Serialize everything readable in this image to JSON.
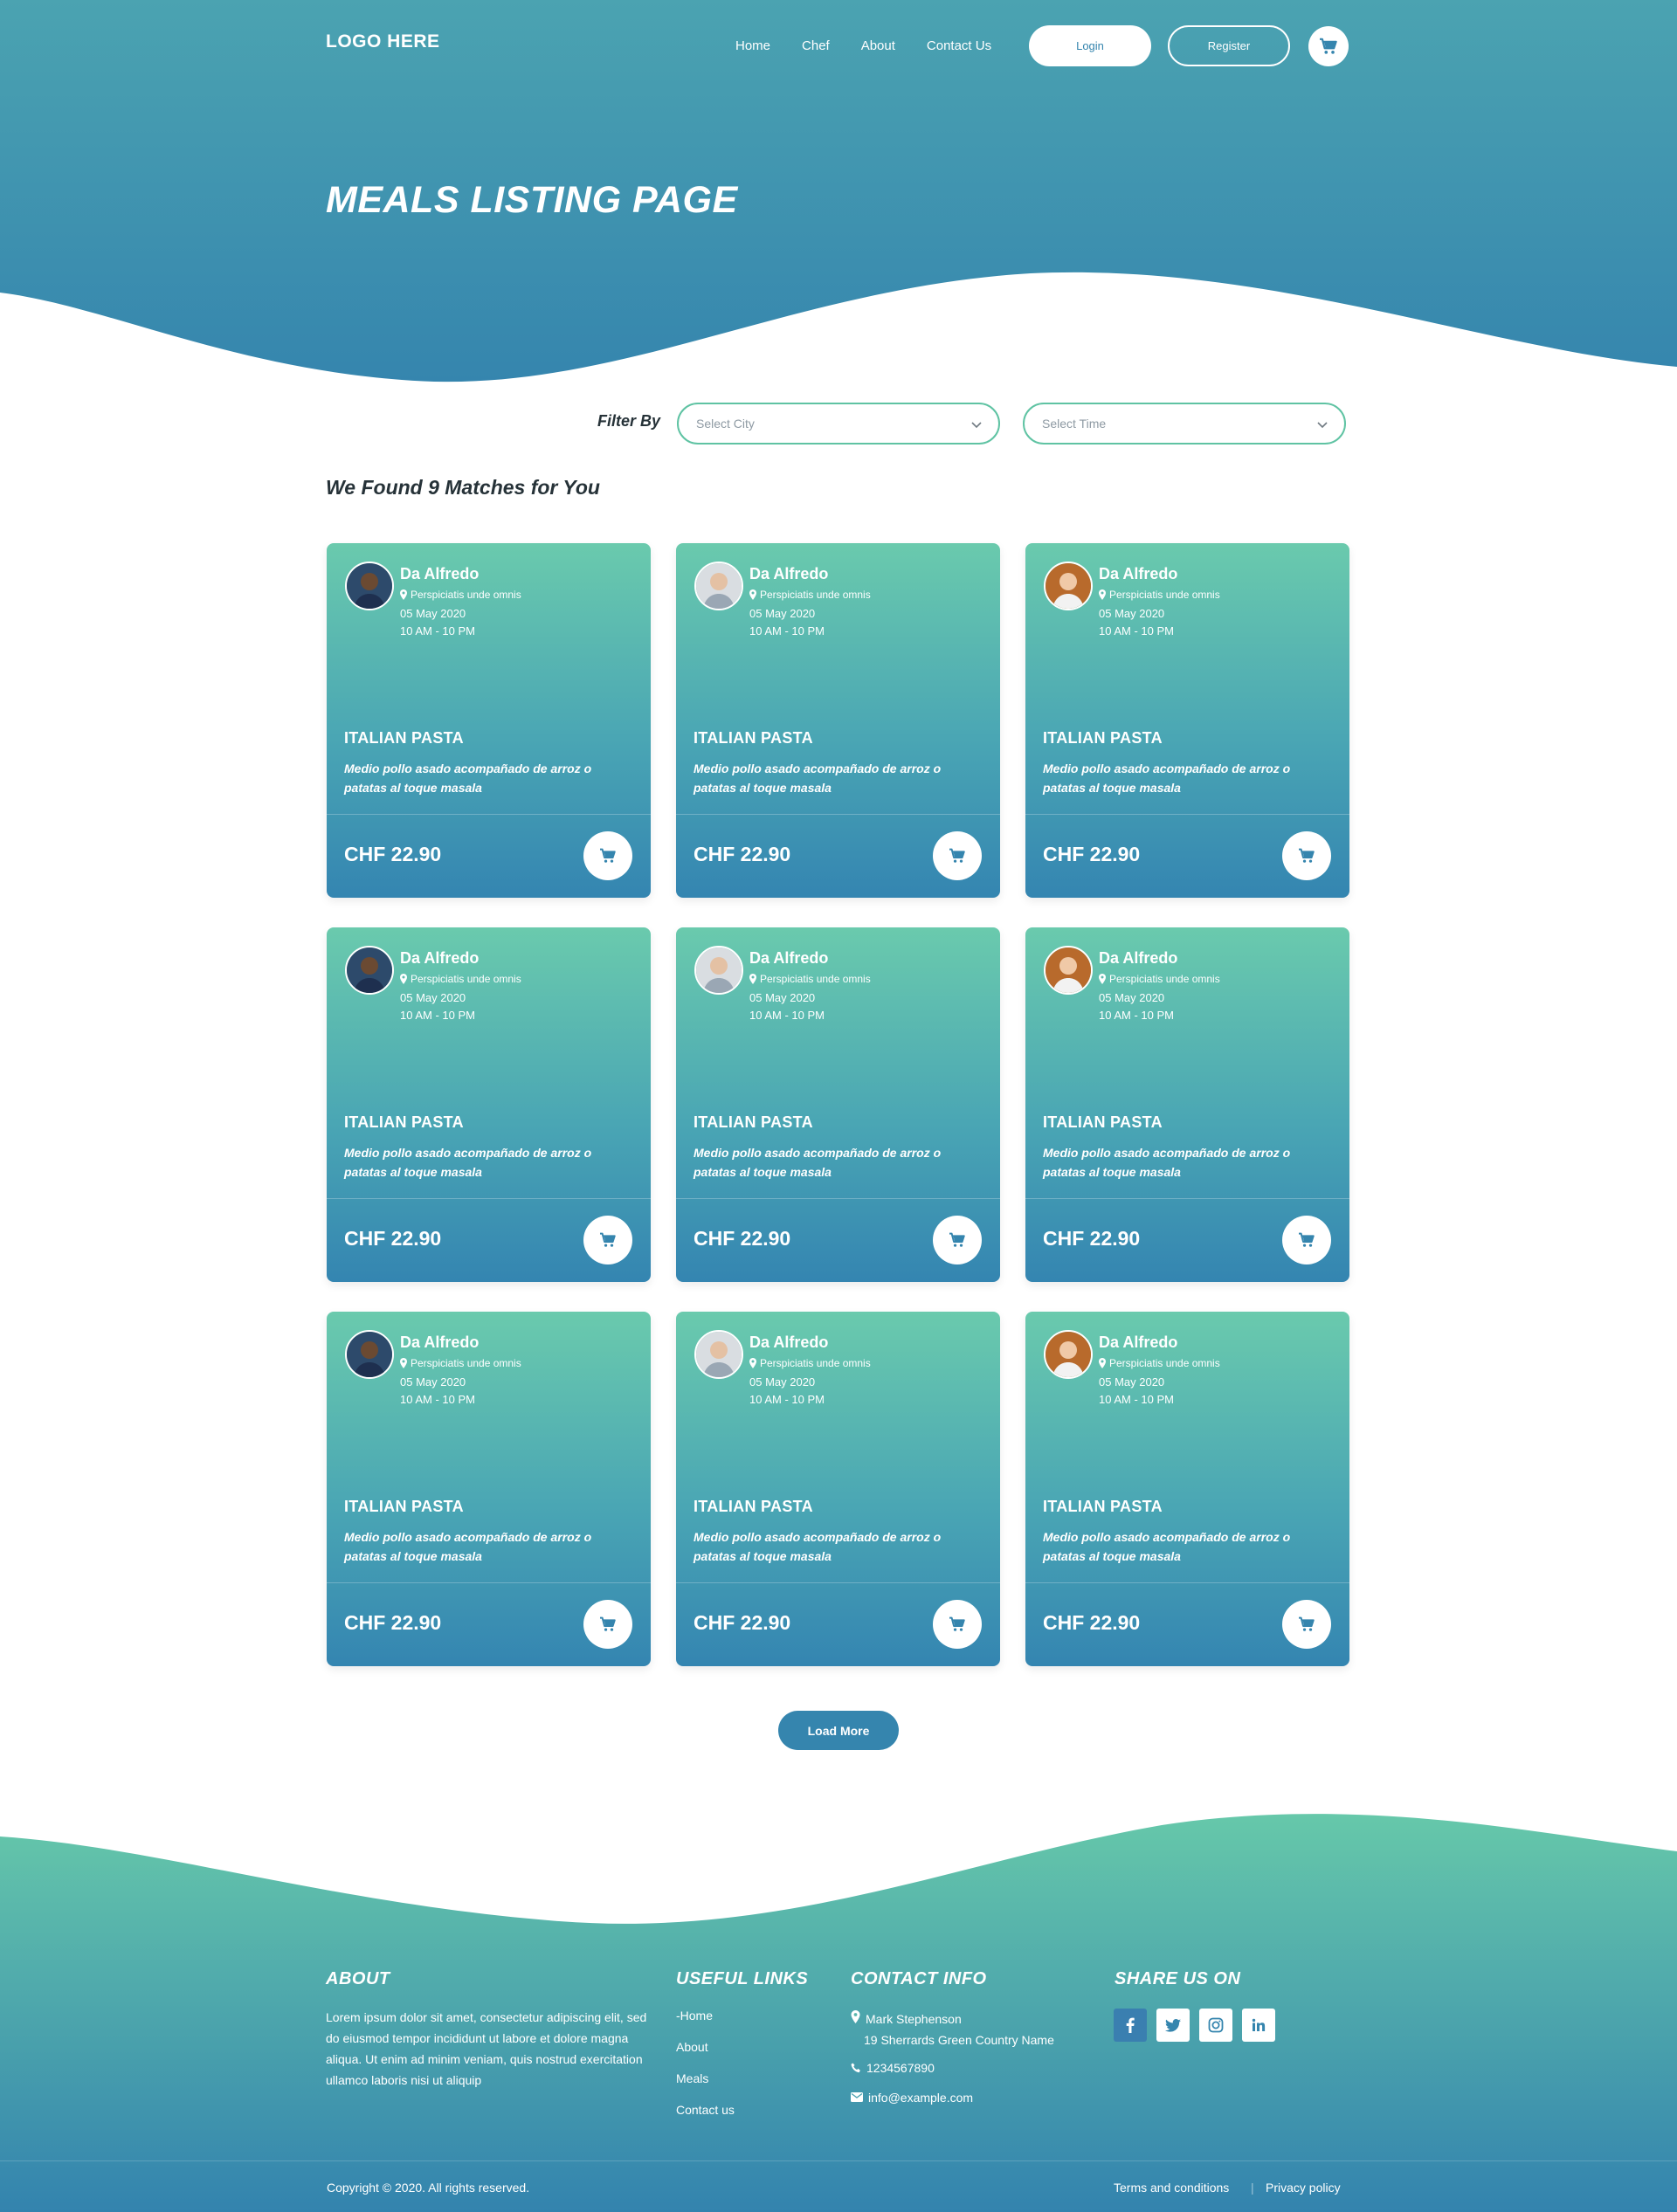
{
  "header": {
    "logo": "LOGO HERE",
    "nav": [
      "Home",
      "Chef",
      "About",
      "Contact Us"
    ],
    "login_label": "Login",
    "register_label": "Register",
    "cart_icon": "cart-icon"
  },
  "hero": {
    "title": "MEALS LISTING PAGE"
  },
  "filter": {
    "label": "Filter By",
    "city_placeholder": "Select City",
    "time_placeholder": "Select Time"
  },
  "results": {
    "summary": "We Found 9 Matches for You",
    "cards": [
      {
        "chef": "Da Alfredo",
        "location": "Perspiciatis unde omnis",
        "date": "05 May 2020",
        "time": "10 AM - 10 PM",
        "meal": "ITALIAN PASTA",
        "description": "Medio pollo asado acompañado de arroz o patatas al toque masala",
        "price": "CHF 22.90"
      },
      {
        "chef": "Da Alfredo",
        "location": "Perspiciatis unde omnis",
        "date": "05 May 2020",
        "time": "10 AM - 10 PM",
        "meal": "ITALIAN PASTA",
        "description": "Medio pollo asado acompañado de arroz o patatas al toque masala",
        "price": "CHF 22.90"
      },
      {
        "chef": "Da Alfredo",
        "location": "Perspiciatis unde omnis",
        "date": "05 May 2020",
        "time": "10 AM - 10 PM",
        "meal": "ITALIAN PASTA",
        "description": "Medio pollo asado acompañado de arroz o patatas al toque masala",
        "price": "CHF 22.90"
      },
      {
        "chef": "Da Alfredo",
        "location": "Perspiciatis unde omnis",
        "date": "05 May 2020",
        "time": "10 AM - 10 PM",
        "meal": "ITALIAN PASTA",
        "description": "Medio pollo asado acompañado de arroz o patatas al toque masala",
        "price": "CHF 22.90"
      },
      {
        "chef": "Da Alfredo",
        "location": "Perspiciatis unde omnis",
        "date": "05 May 2020",
        "time": "10 AM - 10 PM",
        "meal": "ITALIAN PASTA",
        "description": "Medio pollo asado acompañado de arroz o patatas al toque masala",
        "price": "CHF 22.90"
      },
      {
        "chef": "Da Alfredo",
        "location": "Perspiciatis unde omnis",
        "date": "05 May 2020",
        "time": "10 AM - 10 PM",
        "meal": "ITALIAN PASTA",
        "description": "Medio pollo asado acompañado de arroz o patatas al toque masala",
        "price": "CHF 22.90"
      },
      {
        "chef": "Da Alfredo",
        "location": "Perspiciatis unde omnis",
        "date": "05 May 2020",
        "time": "10 AM - 10 PM",
        "meal": "ITALIAN PASTA",
        "description": "Medio pollo asado acompañado de arroz o patatas al toque masala",
        "price": "CHF 22.90"
      },
      {
        "chef": "Da Alfredo",
        "location": "Perspiciatis unde omnis",
        "date": "05 May 2020",
        "time": "10 AM - 10 PM",
        "meal": "ITALIAN PASTA",
        "description": "Medio pollo asado acompañado de arroz o patatas al toque masala",
        "price": "CHF 22.90"
      },
      {
        "chef": "Da Alfredo",
        "location": "Perspiciatis unde omnis",
        "date": "05 May 2020",
        "time": "10 AM - 10 PM",
        "meal": "ITALIAN PASTA",
        "description": "Medio pollo asado acompañado de arroz o patatas al toque masala",
        "price": "CHF 22.90"
      }
    ],
    "load_more": "Load More"
  },
  "footer": {
    "about_title": "ABOUT",
    "about_text": "Lorem ipsum dolor sit amet, consectetur adipiscing elit, sed do eiusmod tempor incididunt ut labore et dolore magna aliqua. Ut enim ad minim veniam, quis nostrud exercitation ullamco laboris nisi ut aliquip",
    "links_title": "USEFUL LINKS",
    "links": [
      "-Home",
      "About",
      "Meals",
      "Contact us"
    ],
    "contact_title": "CONTACT INFO",
    "contact_name": "Mark Stephenson",
    "contact_address": "19 Sherrards Green Country Name",
    "phone": "1234567890",
    "email": "info@example.com",
    "share_title": "SHARE US ON",
    "social_icons": [
      "facebook-icon",
      "twitter-icon",
      "instagram-icon",
      "linkedin-icon"
    ],
    "copyright": "Copyright © 2020. All rights reserved.",
    "terms": "Terms and conditions",
    "separator": "|",
    "privacy": "Privacy policy"
  },
  "colors": {
    "hero_top": "#4ba3b1",
    "hero_bottom": "#3585ae",
    "card_top": "#6acaad",
    "card_bottom": "#3485b1",
    "accent": "#3585ae",
    "filter_border": "#5fc3a3",
    "footer_top": "#66c8aa",
    "footer_bottom": "#3383ae"
  }
}
